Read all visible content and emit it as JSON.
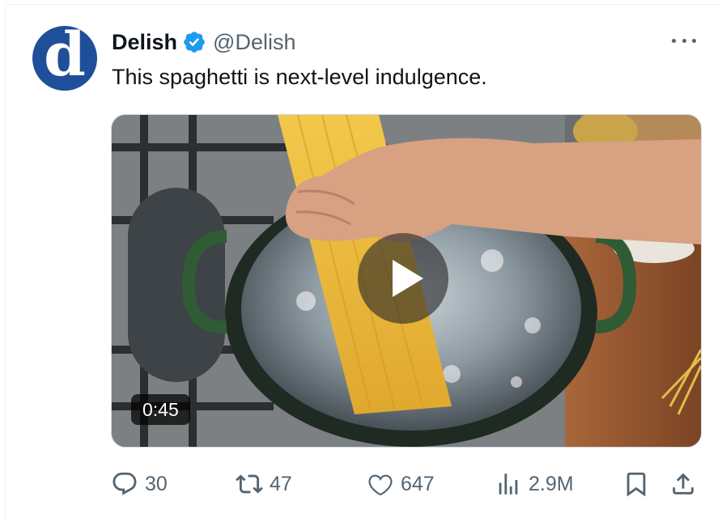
{
  "tweet": {
    "author": {
      "display_name": "Delish",
      "handle": "@Delish",
      "verified": true,
      "avatar_letter": "d",
      "avatar_color": "#1f4f9a"
    },
    "text": "This spaghetti is next-level indulgence.",
    "media": {
      "type": "video",
      "duration": "0:45",
      "play_icon": "play-icon"
    },
    "actions": {
      "replies": {
        "icon": "reply-icon",
        "count": "30"
      },
      "reposts": {
        "icon": "repost-icon",
        "count": "47"
      },
      "likes": {
        "icon": "like-icon",
        "count": "647"
      },
      "views": {
        "icon": "views-icon",
        "count": "2.9M"
      },
      "bookmark": {
        "icon": "bookmark-icon"
      },
      "share": {
        "icon": "share-icon"
      }
    }
  },
  "colors": {
    "text_primary": "#0f1419",
    "text_secondary": "#536471",
    "verified_blue": "#1d9bf0",
    "border": "#cfd9de"
  }
}
